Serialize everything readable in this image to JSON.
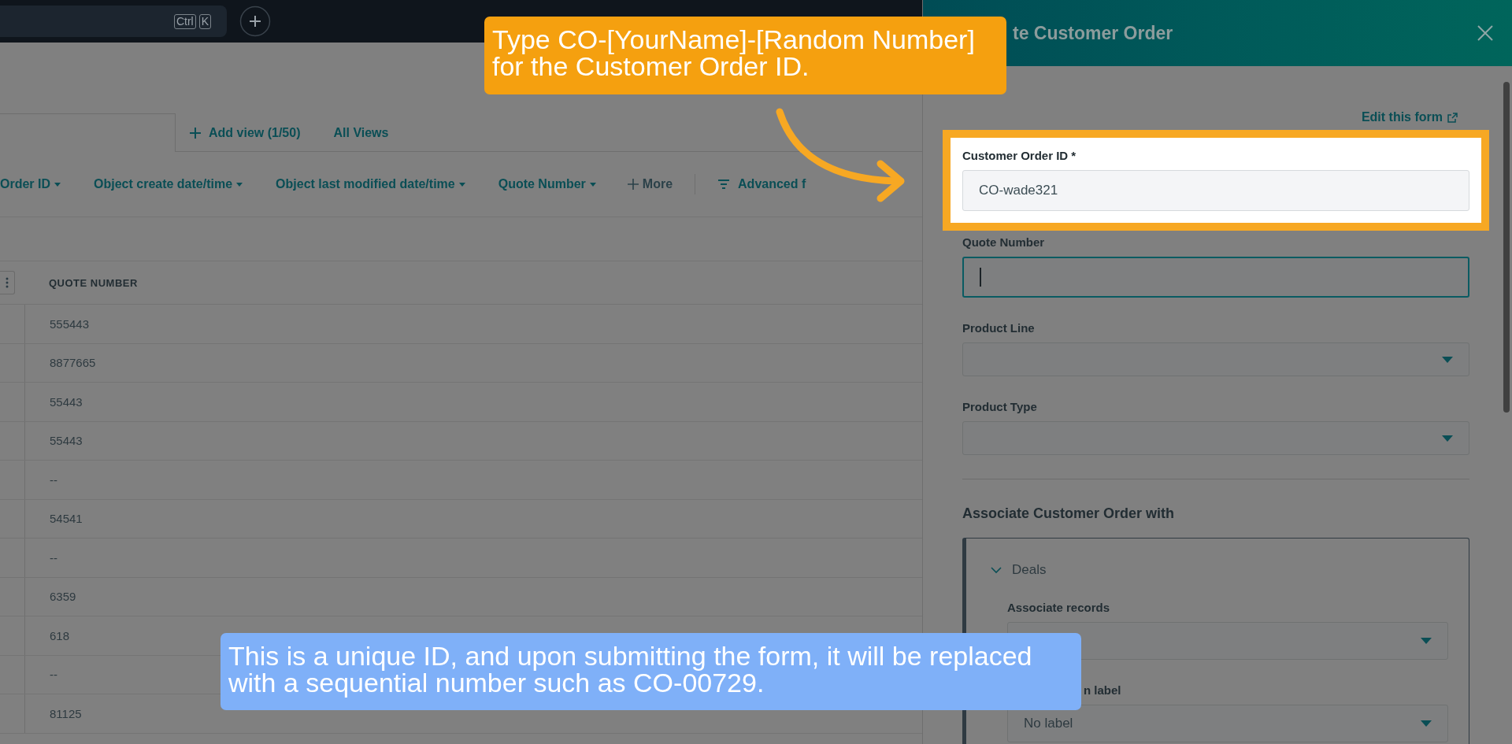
{
  "top_bar": {
    "shortcut_keys": [
      "Ctrl",
      "K"
    ]
  },
  "views": {
    "add_view": "Add view (1/50)",
    "all_views": "All Views"
  },
  "filters": [
    {
      "label": "Order ID",
      "kind": "dropdown"
    },
    {
      "label": "Object create date/time",
      "kind": "dropdown"
    },
    {
      "label": "Object last modified date/time",
      "kind": "dropdown"
    },
    {
      "label": "Quote Number",
      "kind": "dropdown"
    },
    {
      "label": "More",
      "kind": "add"
    },
    {
      "label": "Advanced f",
      "kind": "advanced"
    }
  ],
  "table": {
    "columns": [
      "QUOTE NUMBER"
    ],
    "rows": [
      "555443",
      "8877665",
      "55443",
      "55443",
      "--",
      "54541",
      "--",
      "6359",
      "618",
      "--",
      "81125"
    ]
  },
  "panel": {
    "title": "te Customer Order",
    "edit_link": "Edit this form",
    "fields": [
      {
        "label": "Customer Order ID *",
        "kind": "text",
        "value": "CO-wade321",
        "highlighted": true
      },
      {
        "label": "Quote Number",
        "kind": "text",
        "highlighted": false,
        "focused": true
      },
      {
        "label": "Product Line",
        "kind": "select",
        "highlighted": false
      },
      {
        "label": "Product Type",
        "kind": "select",
        "highlighted": false
      }
    ],
    "associate": {
      "heading": "Associate Customer Order with",
      "section": {
        "title": "Deals",
        "expanded": true,
        "fields": [
          {
            "label": "Associate records",
            "kind": "select"
          },
          {
            "label": "n label",
            "kind": "select",
            "value": "No label"
          }
        ]
      }
    }
  },
  "callouts": [
    {
      "kind": "instruction",
      "lines": [
        "Type CO-[YourName]-[Random Number]",
        "for the Customer Order ID."
      ]
    },
    {
      "kind": "note",
      "lines": [
        "This is a unique ID, and upon submitting the form, it will be replaced",
        "with a sequential number such as CO-00729."
      ]
    }
  ]
}
